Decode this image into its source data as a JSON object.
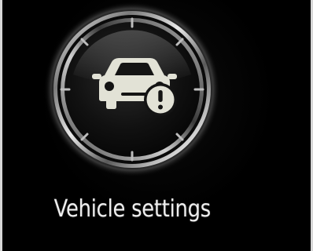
{
  "app": {
    "item_label": "Vehicle settings",
    "icon_name": "car-warning-icon",
    "colors": {
      "background": "#000000",
      "label": "#eeeeee",
      "icon": "#e2e2d6",
      "ring": "#c8c8c8"
    }
  }
}
